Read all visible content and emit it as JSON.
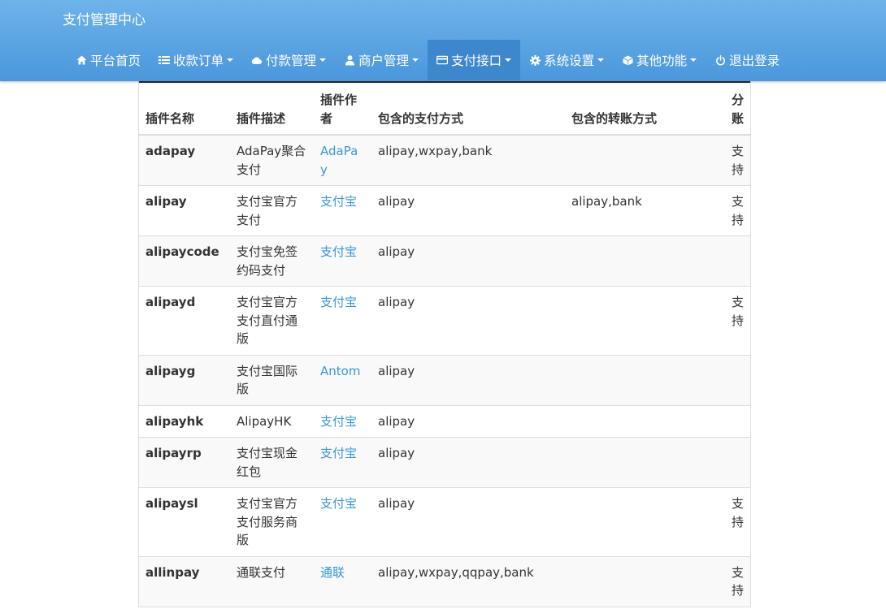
{
  "brand": "支付管理中心",
  "nav": [
    {
      "icon": "home-icon",
      "label": "平台首页",
      "dropdown": false,
      "active": false
    },
    {
      "icon": "list-icon",
      "label": "收款订单",
      "dropdown": true,
      "active": false
    },
    {
      "icon": "cloud-icon",
      "label": "付款管理",
      "dropdown": true,
      "active": false
    },
    {
      "icon": "user-icon",
      "label": "商户管理",
      "dropdown": true,
      "active": false
    },
    {
      "icon": "credit-card-icon",
      "label": "支付接口",
      "dropdown": true,
      "active": true
    },
    {
      "icon": "gear-icon",
      "label": "系统设置",
      "dropdown": true,
      "active": false
    },
    {
      "icon": "cube-icon",
      "label": "其他功能",
      "dropdown": true,
      "active": false
    },
    {
      "icon": "power-icon",
      "label": "退出登录",
      "dropdown": false,
      "active": false
    }
  ],
  "table": {
    "headers": {
      "name": "插件名称",
      "desc": "插件描述",
      "author": "插件作者",
      "pay_methods": "包含的支付方式",
      "transfer_methods": "包含的转账方式",
      "split": "分账"
    },
    "rows": [
      {
        "name": "adapay",
        "desc": "AdaPay聚合支付",
        "author": "AdaPay",
        "pay_methods": "alipay,wxpay,bank",
        "transfer_methods": "",
        "split": "支持"
      },
      {
        "name": "alipay",
        "desc": "支付宝官方支付",
        "author": "支付宝",
        "pay_methods": "alipay",
        "transfer_methods": "alipay,bank",
        "split": "支持"
      },
      {
        "name": "alipaycode",
        "desc": "支付宝免签约码支付",
        "author": "支付宝",
        "pay_methods": "alipay",
        "transfer_methods": "",
        "split": ""
      },
      {
        "name": "alipayd",
        "desc": "支付宝官方支付直付通版",
        "author": "支付宝",
        "pay_methods": "alipay",
        "transfer_methods": "",
        "split": "支持"
      },
      {
        "name": "alipayg",
        "desc": "支付宝国际版",
        "author": "Antom",
        "pay_methods": "alipay",
        "transfer_methods": "",
        "split": ""
      },
      {
        "name": "alipayhk",
        "desc": "AlipayHK",
        "author": "支付宝",
        "pay_methods": "alipay",
        "transfer_methods": "",
        "split": ""
      },
      {
        "name": "alipayrp",
        "desc": "支付宝现金红包",
        "author": "支付宝",
        "pay_methods": "alipay",
        "transfer_methods": "",
        "split": ""
      },
      {
        "name": "alipaysl",
        "desc": "支付宝官方支付服务商版",
        "author": "支付宝",
        "pay_methods": "alipay",
        "transfer_methods": "",
        "split": "支持"
      },
      {
        "name": "allinpay",
        "desc": "通联支付",
        "author": "通联",
        "pay_methods": "alipay,wxpay,qqpay,bank",
        "transfer_methods": "",
        "split": "支持"
      }
    ]
  }
}
